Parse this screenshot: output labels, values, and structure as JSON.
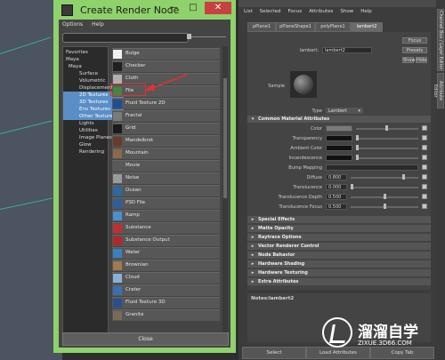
{
  "window": {
    "title": "Create Render Node",
    "minimize": "—",
    "maximize": "□",
    "close": "✕"
  },
  "menu": [
    "Options",
    "Help"
  ],
  "tree": [
    {
      "label": "Favorites",
      "indent": 3,
      "selected": false
    },
    {
      "label": "Maya",
      "indent": 3,
      "selected": false
    },
    {
      "label": "Maya",
      "indent": 6,
      "selected": false
    },
    {
      "label": "Surface",
      "indent": 18,
      "selected": false
    },
    {
      "label": "Volumetric",
      "indent": 18,
      "selected": false
    },
    {
      "label": "Displacement",
      "indent": 18,
      "selected": false
    },
    {
      "label": "2D Textures",
      "indent": 18,
      "selected": true
    },
    {
      "label": "3D Textures",
      "indent": 18,
      "selected": true
    },
    {
      "label": "Env Textures",
      "indent": 18,
      "selected": true
    },
    {
      "label": "Other Textures",
      "indent": 18,
      "selected": true
    },
    {
      "label": "Lights",
      "indent": 18,
      "selected": false
    },
    {
      "label": "Utilities",
      "indent": 18,
      "selected": false
    },
    {
      "label": "Image Planes",
      "indent": 18,
      "selected": false
    },
    {
      "label": "Glow",
      "indent": 18,
      "selected": false
    },
    {
      "label": "Rendering",
      "indent": 18,
      "selected": false
    }
  ],
  "nodes": [
    {
      "label": "Bulge",
      "color": "#f0f0f0"
    },
    {
      "label": "Checker",
      "color": "#202020"
    },
    {
      "label": "Cloth",
      "color": "#b0b0b0"
    },
    {
      "label": "File",
      "color": "#3d8a3d"
    },
    {
      "label": "Fluid Texture 2D",
      "color": "#1f4f8f"
    },
    {
      "label": "Fractal",
      "color": "#7a7a7a"
    },
    {
      "label": "Grid",
      "color": "#1a1a1a"
    },
    {
      "label": "Mandelbrot",
      "color": "#6a3a2a"
    },
    {
      "label": "Mountain",
      "color": "#8a6a4a"
    },
    {
      "label": "Movie",
      "color": "#5a5a5a"
    },
    {
      "label": "Noise",
      "color": "#9a9a9a"
    },
    {
      "label": "Ocean",
      "color": "#2a6aa0"
    },
    {
      "label": "PSD File",
      "color": "#2d5f9a"
    },
    {
      "label": "Ramp",
      "color": "#4a90d0"
    },
    {
      "label": "Substance",
      "color": "#c03030"
    },
    {
      "label": "Substance Output",
      "color": "#b02828"
    },
    {
      "label": "Water",
      "color": "#3a80c0"
    },
    {
      "label": "Brownian",
      "color": "#a07a50"
    },
    {
      "label": "Cloud",
      "color": "#8ab0d8"
    },
    {
      "label": "Crater",
      "color": "#3a70b0"
    },
    {
      "label": "Fluid Texture 3D",
      "color": "#2a4f8f"
    },
    {
      "label": "Granite",
      "color": "#7a6a5a"
    }
  ],
  "close_button": "Close",
  "attribute_editor": {
    "menu": [
      "List",
      "Selected",
      "Focus",
      "Attributes",
      "Show",
      "Help"
    ],
    "tabs": [
      "pPlane1",
      "pPlaneShape1",
      "polyPlane1",
      "lambert2"
    ],
    "name_label": "lambert:",
    "name_value": "lambert2",
    "focus": "Focus",
    "presets": "Presets",
    "show": "Show",
    "hide": "Hide",
    "sample_label": "Sample",
    "type_label": "Type",
    "type_value": "Lambert",
    "common_header": "Common Material Attributes",
    "attrs": [
      {
        "label": "Color",
        "value": "",
        "swatch": "#7a7a7a"
      },
      {
        "label": "Transparency",
        "value": "",
        "swatch": "#111111"
      },
      {
        "label": "Ambient Color",
        "value": "",
        "swatch": "#111111"
      },
      {
        "label": "Incandescence",
        "value": "",
        "swatch": "#111111"
      },
      {
        "label": "Bump Mapping",
        "value": "",
        "swatch": ""
      },
      {
        "label": "Diffuse",
        "value": "0.800",
        "swatch": ""
      },
      {
        "label": "Translucence",
        "value": "0.000",
        "swatch": ""
      },
      {
        "label": "Translucence Depth",
        "value": "0.500",
        "swatch": ""
      },
      {
        "label": "Translucence Focus",
        "value": "0.500",
        "swatch": ""
      }
    ],
    "sections": [
      "Special Effects",
      "Matte Opacity",
      "Raytrace Options",
      "Vector Renderer Control",
      "Node Behavior",
      "Hardware Shading",
      "Hardware Texturing",
      "Extra Attributes"
    ],
    "notes_label": "Notes:",
    "notes_value": "lambert2",
    "bottom_buttons": [
      "Select",
      "Load Attributes",
      "Copy Tab"
    ]
  },
  "side_tabs": [
    "Channel Box / Layer Editor",
    "Attribute Editor"
  ],
  "watermark": {
    "title": "溜溜自学",
    "url": "ZIXUE.3D66.COM"
  }
}
